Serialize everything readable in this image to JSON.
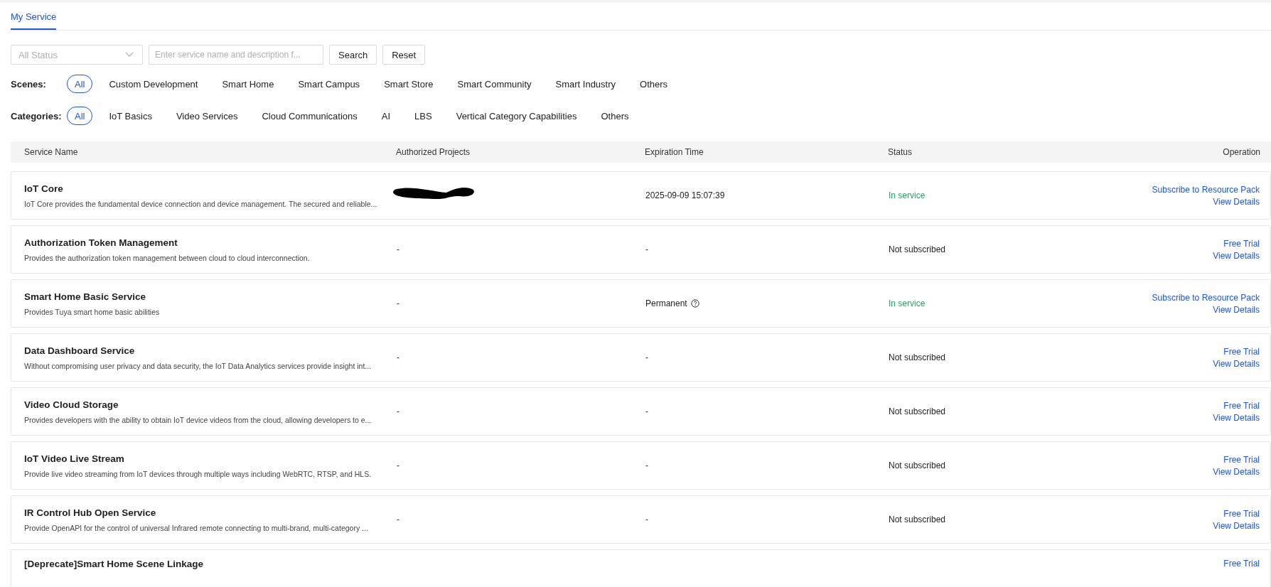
{
  "tabs": [
    {
      "label": "My Service",
      "selected": true
    }
  ],
  "filters": {
    "status_select": {
      "placeholder": "All Status"
    },
    "search": {
      "placeholder": "Enter service name and description f..."
    },
    "buttons": [
      "Search",
      "Reset"
    ]
  },
  "scenes": {
    "label": "Scenes:",
    "options": [
      {
        "label": "All",
        "selected": true
      },
      {
        "label": "Custom Development",
        "selected": false
      },
      {
        "label": "Smart Home",
        "selected": false
      },
      {
        "label": "Smart Campus",
        "selected": false
      },
      {
        "label": "Smart Store",
        "selected": false
      },
      {
        "label": "Smart Community",
        "selected": false
      },
      {
        "label": "Smart Industry",
        "selected": false
      },
      {
        "label": "Others",
        "selected": false
      }
    ]
  },
  "categories": {
    "label": "Categories:",
    "options": [
      {
        "label": "All",
        "selected": true
      },
      {
        "label": "IoT Basics",
        "selected": false
      },
      {
        "label": "Video Services",
        "selected": false
      },
      {
        "label": "Cloud Communications",
        "selected": false
      },
      {
        "label": "AI",
        "selected": false
      },
      {
        "label": "LBS",
        "selected": false
      },
      {
        "label": "Vertical Category Capabilities",
        "selected": false
      },
      {
        "label": "Others",
        "selected": false
      }
    ]
  },
  "table": {
    "columns": [
      "Service Name",
      "Authorized Projects",
      "Expiration Time",
      "Status",
      "Operation"
    ],
    "rows": [
      {
        "name": "IoT Core",
        "description": "IoT Core provides the fundamental device connection and device management. The secured and reliable...",
        "projects_redacted": true,
        "expiration": "2025-09-09 15:07:39",
        "expiration_help": false,
        "status": {
          "text": "In service",
          "kind": "active"
        },
        "operations": [
          "Subscribe to Resource Pack",
          "View Details"
        ]
      },
      {
        "name": "Authorization Token Management",
        "description": "Provides the authorization token management between cloud to cloud interconnection.",
        "projects_redacted": false,
        "projects": "-",
        "expiration": "-",
        "expiration_help": false,
        "status": {
          "text": "Not subscribed",
          "kind": "inactive"
        },
        "operations": [
          "Free Trial",
          "View Details"
        ]
      },
      {
        "name": "Smart Home Basic Service",
        "description": "Provides Tuya smart home basic abilities",
        "projects_redacted": false,
        "projects": "-",
        "expiration": "Permanent",
        "expiration_help": true,
        "status": {
          "text": "In service",
          "kind": "active"
        },
        "operations": [
          "Subscribe to Resource Pack",
          "View Details"
        ]
      },
      {
        "name": "Data Dashboard Service",
        "description": "Without compromising user privacy and data security, the IoT Data Analytics services provide insight int...",
        "projects_redacted": false,
        "projects": "-",
        "expiration": "-",
        "expiration_help": false,
        "status": {
          "text": "Not subscribed",
          "kind": "inactive"
        },
        "operations": [
          "Free Trial",
          "View Details"
        ]
      },
      {
        "name": "Video Cloud Storage",
        "description": "Provides developers with the ability to obtain IoT device videos from the cloud, allowing developers to e...",
        "projects_redacted": false,
        "projects": "-",
        "expiration": "-",
        "expiration_help": false,
        "status": {
          "text": "Not subscribed",
          "kind": "inactive"
        },
        "operations": [
          "Free Trial",
          "View Details"
        ]
      },
      {
        "name": "IoT Video Live Stream",
        "description": "Provide live video streaming from IoT devices through multiple ways including WebRTC, RTSP, and HLS.",
        "projects_redacted": false,
        "projects": "-",
        "expiration": "-",
        "expiration_help": false,
        "status": {
          "text": "Not subscribed",
          "kind": "inactive"
        },
        "operations": [
          "Free Trial",
          "View Details"
        ]
      },
      {
        "name": "IR Control Hub Open Service",
        "description": "Provide OpenAPI for the control of universal Infrared remote connecting to multi-brand, multi-category ...",
        "projects_redacted": false,
        "projects": "-",
        "expiration": "-",
        "expiration_help": false,
        "status": {
          "text": "Not subscribed",
          "kind": "inactive"
        },
        "operations": [
          "Free Trial",
          "View Details"
        ]
      },
      {
        "name": "[Deprecate]Smart Home Scene Linkage",
        "operations": [
          "Free Trial"
        ]
      }
    ]
  }
}
